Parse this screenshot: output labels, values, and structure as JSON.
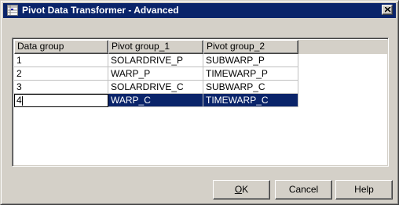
{
  "window": {
    "title": "Pivot Data Transformer - Advanced"
  },
  "table": {
    "columns": [
      "Data group",
      "Pivot group_1",
      "Pivot group_2"
    ],
    "rows": [
      [
        "1",
        "SOLARDRIVE_P",
        "SUBWARP_P"
      ],
      [
        "2",
        "WARP_P",
        "TIMEWARP_P"
      ],
      [
        "3",
        "SOLARDRIVE_C",
        "SUBWARP_C"
      ],
      [
        "4",
        "WARP_C",
        "TIMEWARP_C"
      ]
    ],
    "selected_row": 4
  },
  "buttons": {
    "ok_label": "OK",
    "cancel_label": "Cancel",
    "help_label": "Help"
  },
  "colors": {
    "titlebar": "#0a246a",
    "selection": "#0a246a",
    "face": "#d4d0c8"
  }
}
